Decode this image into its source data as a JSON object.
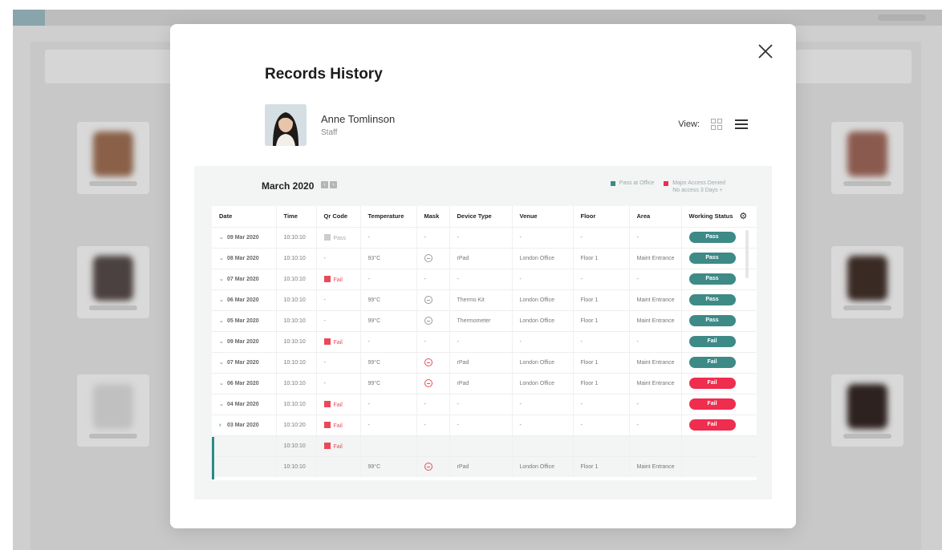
{
  "modal": {
    "title": "Records History",
    "user": {
      "name": "Anne Tomlinson",
      "role": "Staff"
    },
    "view_label": "View:"
  },
  "records": {
    "month": "March 2020",
    "legend": [
      {
        "label": "Pass at Office",
        "sub": "",
        "color": "#3d8a87"
      },
      {
        "label": "Major Access Denied",
        "sub": "No access 3 Days +",
        "color": "#ef2d4f"
      }
    ],
    "columns": [
      "Date",
      "Time",
      "Qr Code",
      "Temperature",
      "Mask",
      "Device Type",
      "Venue",
      "Floor",
      "Area",
      "Working Status"
    ],
    "rows": [
      {
        "date": "09 Mar 2020",
        "time": "10:10:10",
        "qr": "Pass",
        "temp": "-",
        "mask": "-",
        "device": "-",
        "venue": "-",
        "floor": "-",
        "area": "-",
        "status": "Pass"
      },
      {
        "date": "08 Mar 2020",
        "time": "10:10:10",
        "qr": "-",
        "temp": "93°C",
        "mask": "ok",
        "device": "rPad",
        "venue": "London Office",
        "floor": "Floor 1",
        "area": "Maint Entrance",
        "status": "Pass"
      },
      {
        "date": "07 Mar 2020",
        "time": "10:10:10",
        "qr": "Fail",
        "temp": "-",
        "mask": "-",
        "device": "-",
        "venue": "-",
        "floor": "-",
        "area": "-",
        "status": "Pass"
      },
      {
        "date": "06 Mar 2020",
        "time": "10:10:10",
        "qr": "-",
        "temp": "99°C",
        "mask": "ok",
        "device": "Thermo Kit",
        "venue": "London Office",
        "floor": "Floor 1",
        "area": "Maint Entrance",
        "status": "Pass"
      },
      {
        "date": "05 Mar 2020",
        "time": "10:10:10",
        "qr": "-",
        "temp": "99°C",
        "mask": "ok",
        "device": "Thermometer",
        "venue": "London Office",
        "floor": "Floor 1",
        "area": "Maint Entrance",
        "status": "Pass"
      },
      {
        "date": "09 Mar 2020",
        "time": "10:10:10",
        "qr": "Fail",
        "temp": "-",
        "mask": "-",
        "device": "-",
        "venue": "-",
        "floor": "-",
        "area": "-",
        "status": "Fail",
        "pill": "teal"
      },
      {
        "date": "07 Mar 2020",
        "time": "10:10:10",
        "qr": "-",
        "temp": "99°C",
        "mask": "bad",
        "device": "rPad",
        "venue": "London Office",
        "floor": "Floor 1",
        "area": "Maint Entrance",
        "status": "Fail",
        "pill": "teal"
      },
      {
        "date": "06 Mar 2020",
        "time": "10:10:10",
        "qr": "-",
        "temp": "99°C",
        "mask": "bad",
        "device": "rPad",
        "venue": "London Office",
        "floor": "Floor 1",
        "area": "Maint Entrance",
        "status": "Fail",
        "pill": "red"
      },
      {
        "date": "04 Mar 2020",
        "time": "10:10:10",
        "qr": "Fail",
        "temp": "-",
        "mask": "-",
        "device": "-",
        "venue": "-",
        "floor": "-",
        "area": "-",
        "status": "Fail",
        "pill": "red"
      },
      {
        "date": "03 Mar 2020",
        "time": "10:10:20",
        "qr": "Fail",
        "temp": "-",
        "mask": "-",
        "device": "-",
        "venue": "-",
        "floor": "-",
        "area": "-",
        "status": "Fail",
        "pill": "red",
        "expanded": true
      }
    ],
    "sub_rows": [
      {
        "time": "10:10:10",
        "qr": "Fail",
        "temp": "",
        "mask": "",
        "device": "",
        "venue": "",
        "floor": "",
        "area": ""
      },
      {
        "time": "10:10:10",
        "qr": "",
        "temp": "99°C",
        "mask": "bad",
        "device": "rPad",
        "venue": "London Office",
        "floor": "Floor 1",
        "area": "Maint Entrance"
      }
    ]
  },
  "colors": {
    "teal": "#3d8a87",
    "red": "#ef2d4f",
    "accent": "#2b8a87"
  },
  "icons": [
    "close-icon",
    "grid-view-icon",
    "list-view-icon",
    "qr-code-icon",
    "mask-icon",
    "gear-icon",
    "chevron-down-icon",
    "chevron-right-icon"
  ]
}
